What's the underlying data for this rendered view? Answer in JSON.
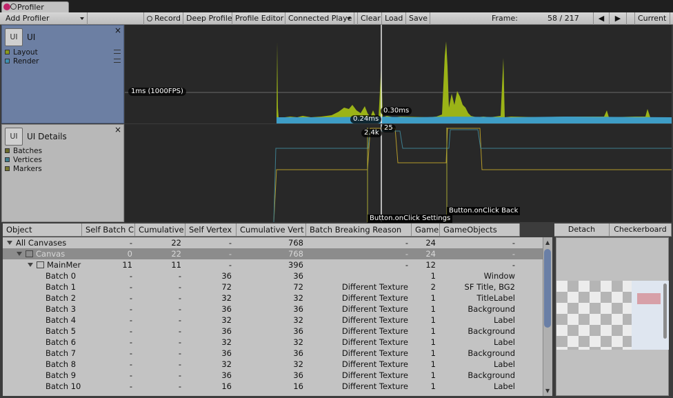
{
  "window": {
    "tab_label": "Profiler"
  },
  "toolbar": {
    "add_profiler": "Add Profiler",
    "record": "Record",
    "deep_profile": "Deep Profile",
    "profile_editor": "Profile Editor",
    "connected_player": "Connected Playe",
    "clear": "Clear",
    "load": "Load",
    "save": "Save",
    "frame_label": "Frame:",
    "frame_value": "58 / 217",
    "current": "Current"
  },
  "panels": {
    "ui": {
      "badge": "UI",
      "title": "UI",
      "close": "×",
      "legend": [
        {
          "label": "Layout",
          "color": "#8a9a1e"
        },
        {
          "label": "Render",
          "color": "#3e91b3"
        }
      ]
    },
    "ui_details": {
      "badge": "UI",
      "title": "UI Details",
      "close": "×",
      "legend": [
        {
          "label": "Batches",
          "color": "#6b6b2a"
        },
        {
          "label": "Vertices",
          "color": "#3e7f8f"
        },
        {
          "label": "Markers",
          "color": "#7a7a30"
        }
      ]
    }
  },
  "graph_ui": {
    "scale_label": "1ms (1000FPS)",
    "value_label_1": "0.30ms",
    "value_label_2": "0.24ms",
    "colors": {
      "layout": "#9bb317",
      "render": "#3e9dc6"
    }
  },
  "graph_details": {
    "value_label_1": "25",
    "value_label_2": "2.4k",
    "marker_1": "Button.onClick Settings",
    "marker_2": "Button.onClick Back",
    "colors": {
      "batches": "#b59a2a",
      "vertices": "#3e7f8f",
      "markers": "#a8a834"
    }
  },
  "table": {
    "columns": [
      "Object",
      "Self Batch C",
      "Cumulative",
      "Self Vertex",
      "Cumulative Vert",
      "Batch Breaking Reason",
      "Game",
      "GameObjects"
    ],
    "rows": [
      {
        "name": "All Canvases",
        "self_batch": "-",
        "cumulative": "22",
        "self_vertex": "-",
        "cum_vert": "768",
        "reason": "-",
        "game": "24",
        "gameobjects": "-"
      },
      {
        "name": "Canvas",
        "self_batch": "0",
        "cumulative": "22",
        "self_vertex": "-",
        "cum_vert": "768",
        "reason": "-",
        "game": "24",
        "gameobjects": "-"
      },
      {
        "name": "MainMer",
        "self_batch": "11",
        "cumulative": "11",
        "self_vertex": "-",
        "cum_vert": "396",
        "reason": "-",
        "game": "12",
        "gameobjects": "-"
      },
      {
        "name": "Batch 0",
        "self_batch": "-",
        "cumulative": "-",
        "self_vertex": "36",
        "cum_vert": "36",
        "reason": "",
        "game": "1",
        "gameobjects": "Window"
      },
      {
        "name": "Batch 1",
        "self_batch": "-",
        "cumulative": "-",
        "self_vertex": "72",
        "cum_vert": "72",
        "reason": "Different Texture",
        "game": "2",
        "gameobjects": "SF Title, BG2"
      },
      {
        "name": "Batch 2",
        "self_batch": "-",
        "cumulative": "-",
        "self_vertex": "32",
        "cum_vert": "32",
        "reason": "Different Texture",
        "game": "1",
        "gameobjects": "TitleLabel"
      },
      {
        "name": "Batch 3",
        "self_batch": "-",
        "cumulative": "-",
        "self_vertex": "36",
        "cum_vert": "36",
        "reason": "Different Texture",
        "game": "1",
        "gameobjects": "Background"
      },
      {
        "name": "Batch 4",
        "self_batch": "-",
        "cumulative": "-",
        "self_vertex": "32",
        "cum_vert": "32",
        "reason": "Different Texture",
        "game": "1",
        "gameobjects": "Label"
      },
      {
        "name": "Batch 5",
        "self_batch": "-",
        "cumulative": "-",
        "self_vertex": "36",
        "cum_vert": "36",
        "reason": "Different Texture",
        "game": "1",
        "gameobjects": "Background"
      },
      {
        "name": "Batch 6",
        "self_batch": "-",
        "cumulative": "-",
        "self_vertex": "32",
        "cum_vert": "32",
        "reason": "Different Texture",
        "game": "1",
        "gameobjects": "Label"
      },
      {
        "name": "Batch 7",
        "self_batch": "-",
        "cumulative": "-",
        "self_vertex": "36",
        "cum_vert": "36",
        "reason": "Different Texture",
        "game": "1",
        "gameobjects": "Background"
      },
      {
        "name": "Batch 8",
        "self_batch": "-",
        "cumulative": "-",
        "self_vertex": "32",
        "cum_vert": "32",
        "reason": "Different Texture",
        "game": "1",
        "gameobjects": "Label"
      },
      {
        "name": "Batch 9",
        "self_batch": "-",
        "cumulative": "-",
        "self_vertex": "36",
        "cum_vert": "36",
        "reason": "Different Texture",
        "game": "1",
        "gameobjects": "Background"
      },
      {
        "name": "Batch 10",
        "self_batch": "-",
        "cumulative": "-",
        "self_vertex": "16",
        "cum_vert": "16",
        "reason": "Different Texture",
        "game": "1",
        "gameobjects": "Label"
      }
    ]
  },
  "preview": {
    "detach": "Detach",
    "checkerboard": "Checkerboard"
  }
}
